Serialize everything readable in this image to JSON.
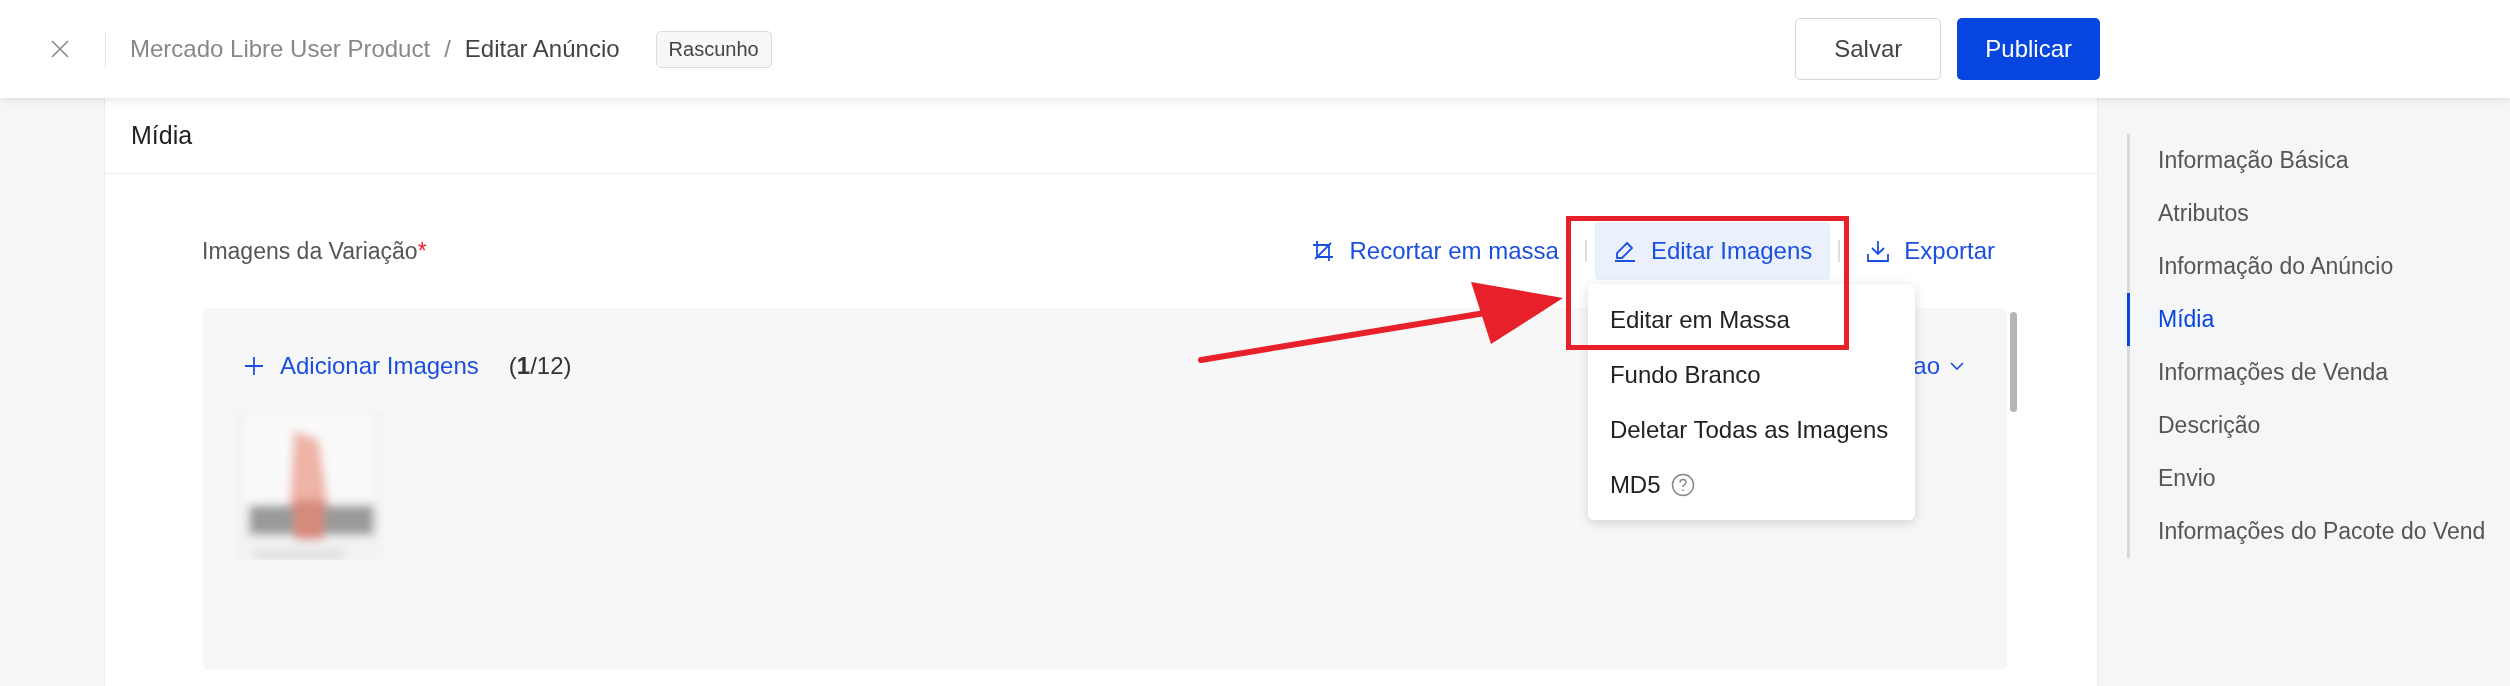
{
  "header": {
    "breadcrumb": [
      "Mercado Libre User Product",
      "Editar Anúncio"
    ],
    "separator": "/",
    "status_badge": "Rascunho",
    "buttons": [
      {
        "label": "Salvar",
        "kind": "secondary"
      },
      {
        "label": "Publicar",
        "kind": "primary"
      }
    ]
  },
  "section": {
    "title": "Mídia",
    "field_label": "Imagens da Variação",
    "required_mark": "*",
    "actions": [
      {
        "label": "Recortar em massa",
        "kind": "crop",
        "selected": false
      },
      {
        "label": "Editar Imagens",
        "kind": "edit",
        "selected": true
      },
      {
        "label": "Exportar",
        "kind": "export",
        "selected": false
      }
    ],
    "add_button": "Adicionar Imagens",
    "count": "(**1**/12)",
    "sort_link": "ao"
  },
  "dropdown": {
    "items": [
      {
        "label": "Editar em Massa",
        "help": false
      },
      {
        "label": "Fundo Branco",
        "help": false
      },
      {
        "label": "Deletar Todas as Imagens",
        "help": false
      },
      {
        "label": "MD5",
        "help": true
      }
    ]
  },
  "sidebar": {
    "items": [
      {
        "label": "Informação Básica",
        "selected": false
      },
      {
        "label": "Atributos",
        "selected": false
      },
      {
        "label": "Informação do Anúncio",
        "selected": false
      },
      {
        "label": "Mídia",
        "selected": true
      },
      {
        "label": "Informações de Venda",
        "selected": false
      },
      {
        "label": "Descrição",
        "selected": false
      },
      {
        "label": "Envio",
        "selected": false
      },
      {
        "label": "Informações do Pacote do Vend",
        "selected": false
      }
    ]
  }
}
